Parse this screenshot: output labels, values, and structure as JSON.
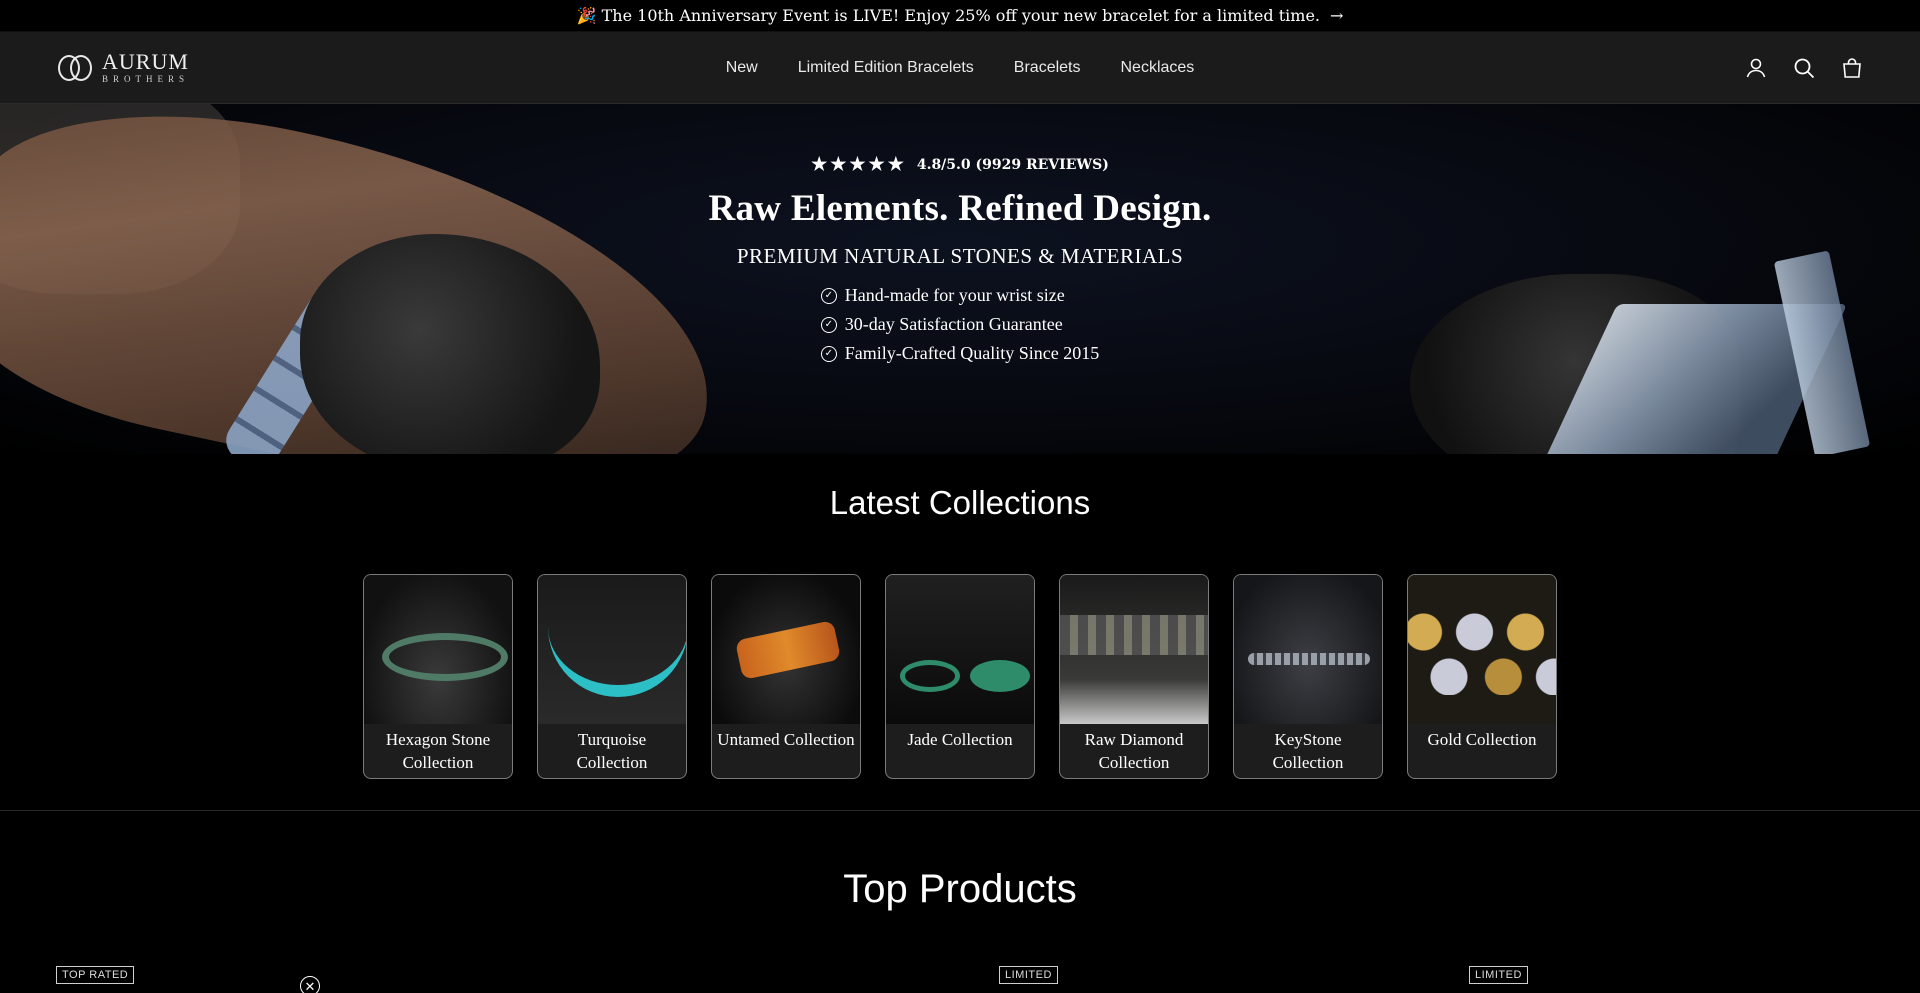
{
  "announcement": {
    "text": "🎉 The 10th Anniversary Event is LIVE! Enjoy 25% off your new bracelet for a limited time.",
    "arrow": "→"
  },
  "header": {
    "logo_name": "AURUM",
    "logo_sub": "BROTHERS",
    "nav": [
      "New",
      "Limited Edition Bracelets",
      "Bracelets",
      "Necklaces"
    ],
    "icons": [
      "account-icon",
      "search-icon",
      "cart-icon"
    ]
  },
  "hero": {
    "stars": "★★★★★",
    "rating": "4.8/5.0 (9929 REVIEWS)",
    "title": "Raw Elements. Refined Design.",
    "subtitle": "PREMIUM NATURAL STONES & MATERIALS",
    "features": [
      "Hand-made for your wrist size",
      "30-day Satisfaction Guarantee",
      "Family-Crafted Quality Since 2015"
    ]
  },
  "collections": {
    "title": "Latest Collections",
    "items": [
      {
        "label": "Hexagon Stone Collection"
      },
      {
        "label": "Turquoise Collection"
      },
      {
        "label": "Untamed Collection"
      },
      {
        "label": "Jade Collection"
      },
      {
        "label": "Raw Diamond Collection"
      },
      {
        "label": "KeyStone Collection"
      },
      {
        "label": "Gold Collection"
      }
    ]
  },
  "top_products": {
    "title": "Top Products",
    "badges": [
      "TOP RATED",
      "LIMITED",
      "LIMITED"
    ],
    "close_glyph": "✕"
  },
  "colors": {
    "background": "#000000",
    "header_bg": "#1b1b1b",
    "text": "#ffffff"
  }
}
